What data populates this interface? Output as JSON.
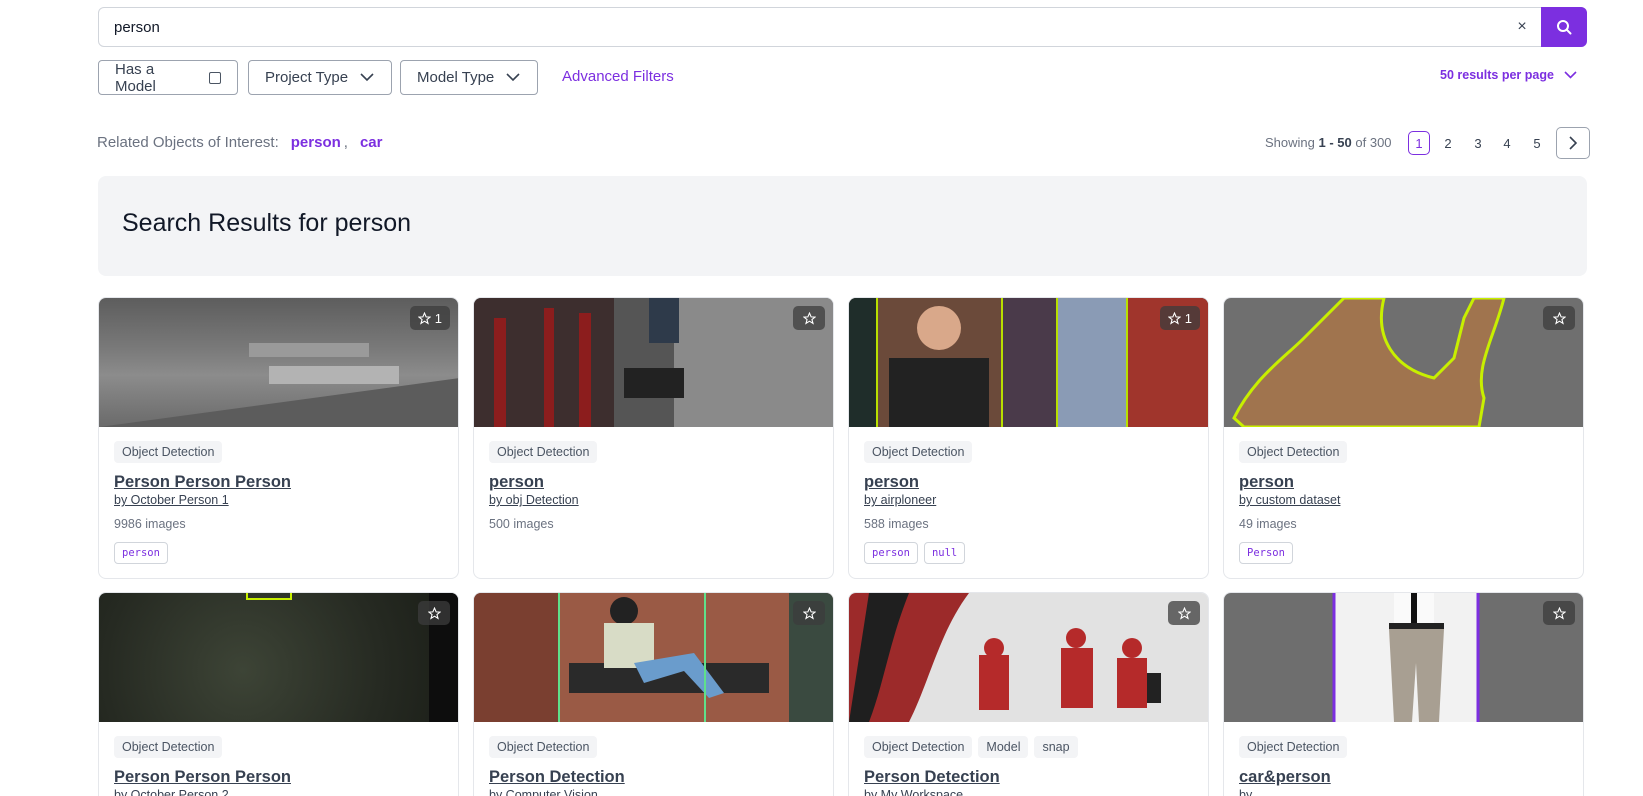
{
  "search": {
    "value": "person",
    "clear": "×"
  },
  "filters": {
    "has_model": "Has a Model",
    "project_type": "Project Type",
    "model_type": "Model Type",
    "advanced": "Advanced Filters",
    "per_page": "50 results per page"
  },
  "related": {
    "label": "Related Objects of Interest:",
    "tags": [
      "person",
      "car"
    ],
    "comma": ","
  },
  "showing": {
    "prefix": "Showing",
    "range": "1 - 50",
    "of": "of",
    "total": "300"
  },
  "pagination": {
    "pages": [
      "1",
      "2",
      "3",
      "4",
      "5"
    ],
    "current": "1"
  },
  "heading": "Search Results for person",
  "accent_color": "#7c2fe0",
  "cards": [
    {
      "badges": [
        "Object Detection"
      ],
      "title": "Person Person Person",
      "by": "by October Person 1",
      "count": "9986 images",
      "classes": [
        "person"
      ],
      "stars": "1"
    },
    {
      "badges": [
        "Object Detection"
      ],
      "title": "person",
      "by": "by obj Detection",
      "count": "500 images",
      "classes": [],
      "stars": ""
    },
    {
      "badges": [
        "Object Detection"
      ],
      "title": "person",
      "by": "by airploneer",
      "count": "588 images",
      "classes": [
        "person",
        "null"
      ],
      "stars": "1"
    },
    {
      "badges": [
        "Object Detection"
      ],
      "title": "person",
      "by": "by custom dataset",
      "count": "49 images",
      "classes": [
        "Person"
      ],
      "stars": ""
    },
    {
      "badges": [
        "Object Detection"
      ],
      "title": "Person Person Person",
      "by": "by October Person 2",
      "count": "",
      "classes": [],
      "stars": ""
    },
    {
      "badges": [
        "Object Detection"
      ],
      "title": "Person Detection",
      "by": "by Computer Vision",
      "count": "",
      "classes": [],
      "stars": ""
    },
    {
      "badges": [
        "Object Detection",
        "Model",
        "snap"
      ],
      "title": "Person Detection",
      "by": "by My Workspace",
      "count": "",
      "classes": [],
      "stars": ""
    },
    {
      "badges": [
        "Object Detection"
      ],
      "title": "car&person",
      "by": "by",
      "count": "",
      "classes": [],
      "stars": ""
    }
  ]
}
